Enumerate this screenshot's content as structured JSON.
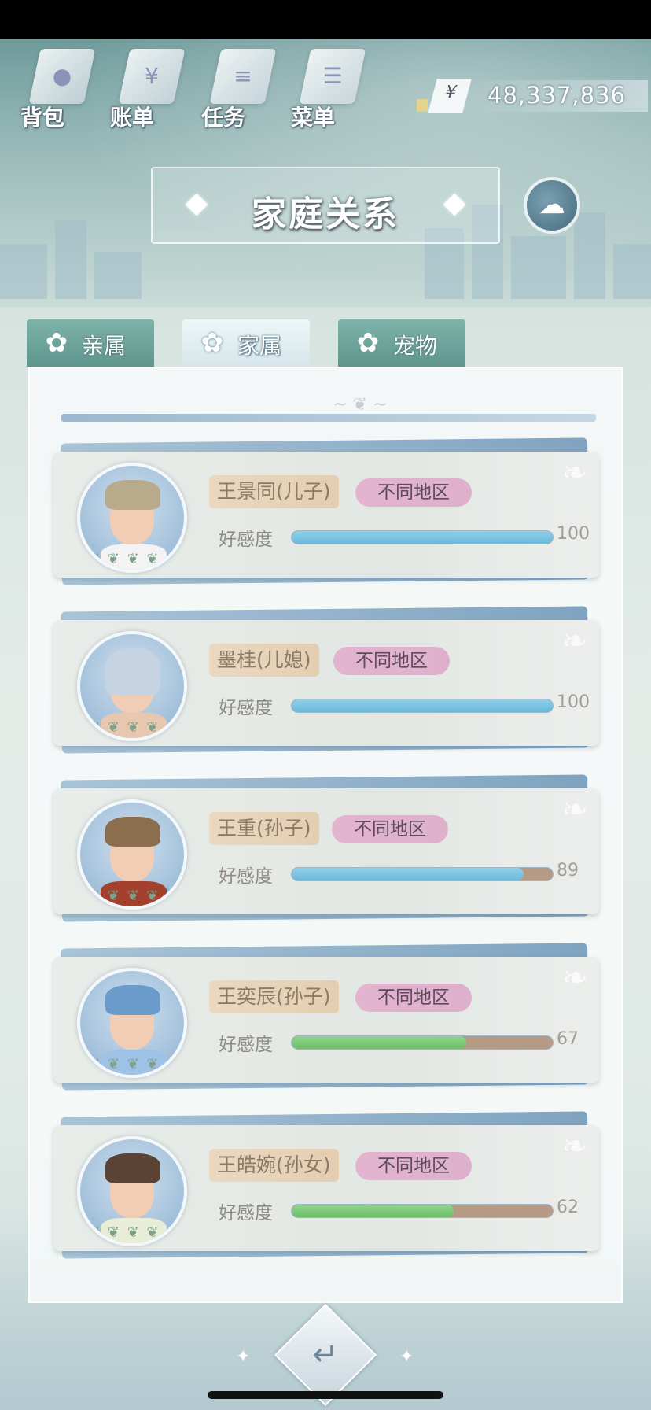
{
  "top_menu": [
    {
      "label": "背包",
      "icon": "bag-icon",
      "glyph": "●"
    },
    {
      "label": "账单",
      "icon": "bill-icon",
      "glyph": "¥"
    },
    {
      "label": "任务",
      "icon": "task-icon",
      "glyph": "≡"
    },
    {
      "label": "菜单",
      "icon": "menu-icon",
      "glyph": "☰"
    }
  ],
  "currency": {
    "symbol": "¥",
    "amount": "48,337,836"
  },
  "title": "家庭关系",
  "tabs": [
    {
      "label": "亲属",
      "active": false
    },
    {
      "label": "家属",
      "active": true
    },
    {
      "label": "宠物",
      "active": false
    }
  ],
  "affinity_label": "好感度",
  "members": [
    {
      "name": "王景同(儿子)",
      "region": "不同地区",
      "affinity": 100,
      "affinity_text": "100",
      "bar": "blue",
      "hair": "#b7ab8c",
      "shirt": "#f3f3f3"
    },
    {
      "name": "墨桂(儿媳)",
      "region": "不同地区",
      "affinity": 100,
      "affinity_text": "100",
      "bar": "blue",
      "hair": "#c6d3e2",
      "shirt": "#e7c7b0"
    },
    {
      "name": "王重(孙子)",
      "region": "不同地区",
      "affinity": 89,
      "affinity_text": "89",
      "bar": "blue",
      "hair": "#8a6e4e",
      "shirt": "#a4402e"
    },
    {
      "name": "王奕辰(孙子)",
      "region": "不同地区",
      "affinity": 67,
      "affinity_text": "67",
      "bar": "green",
      "hair": "#6a9ccb",
      "shirt": "#9ec2e6"
    },
    {
      "name": "王皓婉(孙女)",
      "region": "不同地区",
      "affinity": 62,
      "affinity_text": "62",
      "bar": "green",
      "hair": "#5a4234",
      "shirt": "#e8edd8"
    }
  ],
  "colors": {
    "bar_blue": "#6bb9d8",
    "bar_green": "#6dbf69",
    "bar_track": "#b59a86",
    "region_tag": "#e3b4cf",
    "name_tag": "#ead8bf"
  }
}
